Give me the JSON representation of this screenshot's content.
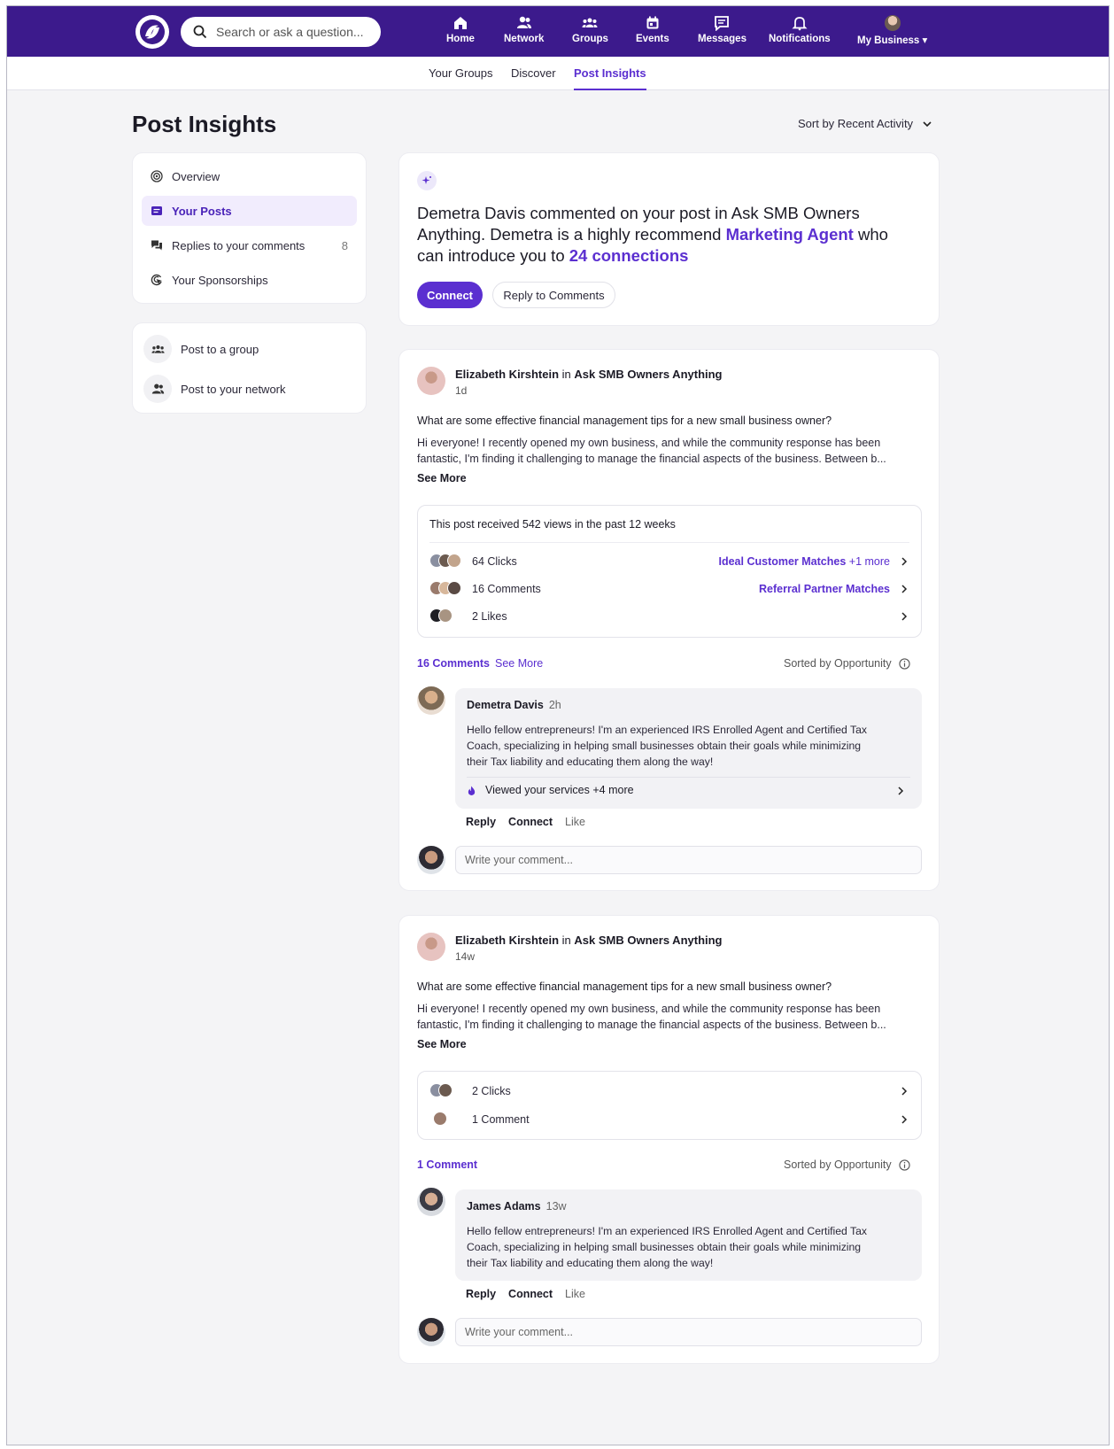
{
  "nav": {
    "search_placeholder": "Search or ask a question...",
    "items": [
      {
        "label": "Home",
        "icon": "home-icon"
      },
      {
        "label": "Network",
        "icon": "people-icon"
      },
      {
        "label": "Groups",
        "icon": "groups-icon"
      },
      {
        "label": "Events",
        "icon": "calendar-icon"
      },
      {
        "label": "Messages",
        "icon": "message-icon"
      },
      {
        "label": "Notifications",
        "icon": "bell-icon"
      },
      {
        "label": "My Business",
        "icon": "avatar"
      }
    ],
    "active": "Groups"
  },
  "subnav": {
    "tabs": [
      "Your Groups",
      "Discover",
      "Post Insights"
    ],
    "active": "Post Insights"
  },
  "page": {
    "title": "Post Insights",
    "sort_label": "Sort by Recent Activity"
  },
  "sidebar": {
    "items": [
      {
        "label": "Overview",
        "icon": "target-icon"
      },
      {
        "label": "Your Posts",
        "icon": "posts-icon"
      },
      {
        "label": "Replies to your comments",
        "icon": "replies-icon",
        "count": "8"
      },
      {
        "label": "Your Sponsorships",
        "icon": "sponsorship-icon"
      }
    ],
    "active": "Your Posts",
    "actions": [
      {
        "label": "Post to a group",
        "icon": "groups-icon"
      },
      {
        "label": "Post to your network",
        "icon": "people-icon"
      }
    ]
  },
  "highlight": {
    "text_1": "Demetra Davis commented on your post in Ask SMB Owners Anything. Demetra is a highly recommend ",
    "link_1": "Marketing Agent",
    "text_2": " who can introduce you to ",
    "link_2": "24 connections",
    "connect_label": "Connect",
    "reply_label": "Reply to Comments"
  },
  "posts": [
    {
      "author": "Elizabeth Kirshtein",
      "in_word": "in",
      "group": "Ask SMB Owners Anything",
      "time": "1d",
      "question": "What are some effective financial management tips for a new small business owner?",
      "body_line_1": "Hi everyone! I recently opened my own business, and while the community response has been",
      "body_line_2": "fantastic, I'm finding it challenging to manage the financial aspects of the business. Between b...",
      "see_more": "See More",
      "stats_header": "This post received 542 views in the past 12 weeks",
      "stats": [
        {
          "label": "64 Clicks",
          "link": "Ideal Customer Matches",
          "extra": "+1 more"
        },
        {
          "label": "16 Comments",
          "link": "Referral Partner Matches",
          "extra": ""
        },
        {
          "label": "2 Likes",
          "link": "",
          "extra": ""
        }
      ],
      "comments_count": "16 Comments",
      "comments_see_more": "See More",
      "sorted_label": "Sorted by Opportunity",
      "comment": {
        "name": "Demetra Davis",
        "time": "2h",
        "line_1": "Hello fellow entrepreneurs! I'm an experienced IRS Enrolled Agent and Certified Tax",
        "line_2": "Coach, specializing in helping small businesses obtain their goals while minimizing",
        "line_3": "their Tax liability and educating them along the way!",
        "viewed": "Viewed your services +4 more"
      },
      "actions": [
        "Reply",
        "Connect",
        "Like"
      ],
      "write_placeholder": "Write your comment..."
    },
    {
      "author": "Elizabeth Kirshtein",
      "in_word": "in",
      "group": "Ask SMB Owners Anything",
      "time": "14w",
      "question": "What are some effective financial management tips for a new small business owner?",
      "body_line_1": "Hi everyone! I recently opened my own business, and while the community response has been",
      "body_line_2": "fantastic, I'm finding it challenging to manage the financial aspects of the business. Between b...",
      "see_more": "See More",
      "stats": [
        {
          "label": "2 Clicks"
        },
        {
          "label": "1 Comment"
        }
      ],
      "comments_count": "1 Comment",
      "sorted_label": "Sorted by Opportunity",
      "comment": {
        "name": "James Adams",
        "time": "13w",
        "line_1": "Hello fellow entrepreneurs! I'm an experienced IRS Enrolled Agent and Certified Tax",
        "line_2": "Coach, specializing in helping small businesses obtain their goals while minimizing",
        "line_3": "their Tax liability and educating them along the way!"
      },
      "actions": [
        "Reply",
        "Connect",
        "Like"
      ],
      "write_placeholder": "Write your comment..."
    }
  ],
  "colors": {
    "nav_bg": "#3c1a8c",
    "accent": "#5b2fd0",
    "page_bg": "#f4f4f6"
  }
}
